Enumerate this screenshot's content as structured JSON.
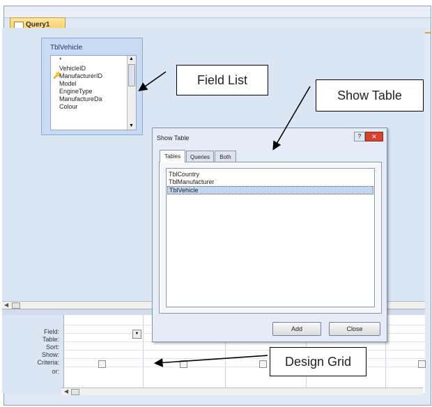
{
  "query_tab": {
    "label": "Query1"
  },
  "field_list": {
    "title": "TblVehicle",
    "fields": [
      "*",
      "VehicleID",
      "ManufacturerID",
      "Model",
      "EngineType",
      "ManufactureDa",
      "Colour"
    ]
  },
  "callouts": {
    "field_list": "Field List",
    "show_table": "Show Table",
    "design_grid": "Design Grid"
  },
  "dialog": {
    "title": "Show Table",
    "help": "?",
    "close": "✕",
    "tabs": [
      "Tables",
      "Queries",
      "Both"
    ],
    "tables": [
      "TblCountry",
      "TblManufacturer",
      "TblVehicle"
    ],
    "selected_index": 2,
    "add_label": "Add",
    "close_label": "Close"
  },
  "design_grid": {
    "row_labels": [
      "Field:",
      "Table:",
      "Sort:",
      "Show:",
      "Criteria:",
      "or:"
    ]
  },
  "colors": {
    "tab_gradient_top": "#fde7a2",
    "tab_gradient_bottom": "#f7c74f",
    "pane_background": "#dbe6f5",
    "selection": "#c3d7f0",
    "dialog_close": "#d8432e"
  }
}
